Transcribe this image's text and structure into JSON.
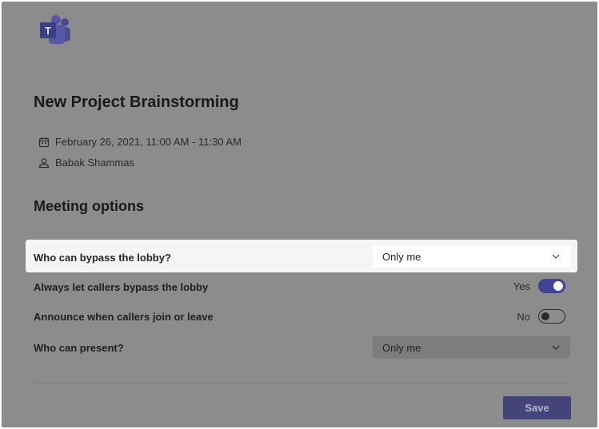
{
  "meeting": {
    "title": "New Project Brainstorming",
    "datetime": "February 26, 2021, 11:00 AM - 11:30 AM",
    "organizer": "Babak Shammas"
  },
  "options": {
    "heading": "Meeting options",
    "bypass_lobby": {
      "label": "Who can bypass the lobby?",
      "value": "Only me"
    },
    "callers_bypass": {
      "label": "Always let callers bypass the lobby",
      "value_label": "Yes",
      "enabled": true
    },
    "announce_callers": {
      "label": "Announce when callers join or leave",
      "value_label": "No",
      "enabled": false
    },
    "presenters": {
      "label": "Who can present?",
      "value": "Only me"
    }
  },
  "actions": {
    "save_label": "Save"
  },
  "colors": {
    "accent": "#464775",
    "toggle_on": "#3f4396",
    "overlay": "#8c8c8c"
  },
  "icons": {
    "logo": "teams-logo",
    "date": "calendar-icon",
    "person": "person-icon",
    "chevron": "chevron-down-icon"
  }
}
